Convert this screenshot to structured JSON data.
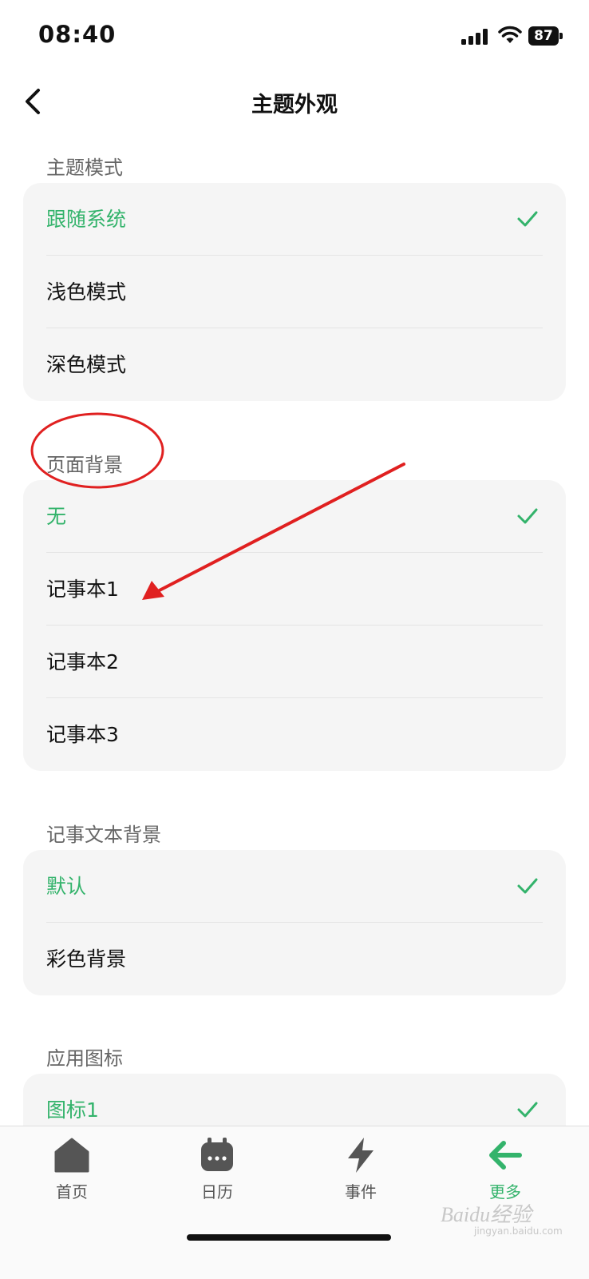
{
  "status": {
    "time": "08:40",
    "battery": "87"
  },
  "nav": {
    "title": "主题外观"
  },
  "sections": [
    {
      "label": "主题模式",
      "items": [
        {
          "label": "跟随系统",
          "selected": true
        },
        {
          "label": "浅色模式",
          "selected": false
        },
        {
          "label": "深色模式",
          "selected": false
        }
      ]
    },
    {
      "label": "页面背景",
      "items": [
        {
          "label": "无",
          "selected": true
        },
        {
          "label": "记事本1",
          "selected": false
        },
        {
          "label": "记事本2",
          "selected": false
        },
        {
          "label": "记事本3",
          "selected": false
        }
      ]
    },
    {
      "label": "记事文本背景",
      "items": [
        {
          "label": "默认",
          "selected": true
        },
        {
          "label": "彩色背景",
          "selected": false
        }
      ]
    },
    {
      "label": "应用图标",
      "items": [
        {
          "label": "图标1",
          "selected": true
        }
      ]
    }
  ],
  "tabs": [
    {
      "label": "首页",
      "icon": "home-icon"
    },
    {
      "label": "日历",
      "icon": "calendar-icon"
    },
    {
      "label": "事件",
      "icon": "lightning-icon"
    },
    {
      "label": "更多",
      "icon": "arrow-left-icon",
      "active": true
    }
  ],
  "watermark": {
    "text": "Baidu经验",
    "sub": "jingyan.baidu.com"
  },
  "colors": {
    "accent": "#33b36b",
    "annotation": "#e02020"
  }
}
